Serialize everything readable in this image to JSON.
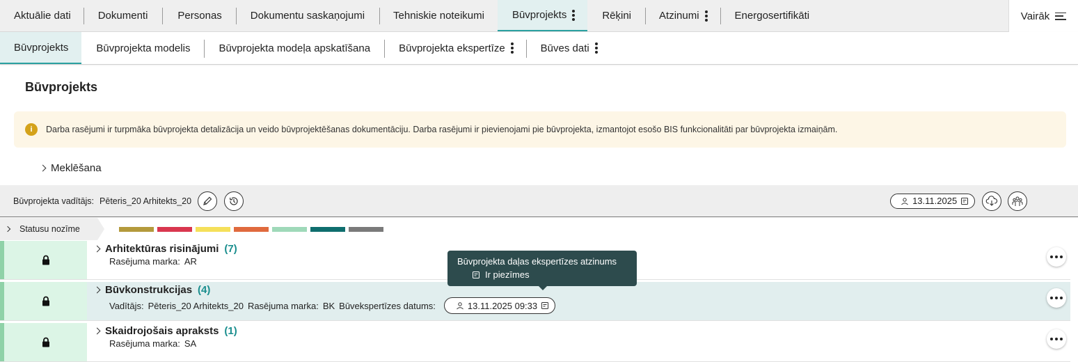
{
  "topnav": {
    "tabs": [
      {
        "label": "Aktuālie dati"
      },
      {
        "label": "Dokumenti"
      },
      {
        "label": "Personas"
      },
      {
        "label": "Dokumentu saskaņojumi"
      },
      {
        "label": "Tehniskie noteikumi"
      },
      {
        "label": "Būvprojekts"
      },
      {
        "label": "Rēķini"
      },
      {
        "label": "Atzinumi"
      },
      {
        "label": "Energosertifikāti"
      }
    ],
    "more_label": "Vairāk"
  },
  "subnav": {
    "tabs": [
      {
        "label": "Būvprojekts"
      },
      {
        "label": "Būvprojekta modelis"
      },
      {
        "label": "Būvprojekta modeļa apskatīšana"
      },
      {
        "label": "Būvprojekta ekspertīze"
      },
      {
        "label": "Būves dati"
      }
    ]
  },
  "page": {
    "title": "Būvprojekts"
  },
  "info": {
    "icon": "info-icon",
    "text": "Darba rasējumi ir turpmāka būvprojekta detalizācija un veido būvprojektēšanas dokumentāciju. Darba rasējumi ir pievienojami pie būvprojekta, izmantojot esošo BIS funkcionalitāti par būvprojekta izmaiņām."
  },
  "search": {
    "label": "Meklēšana"
  },
  "toolbar": {
    "manager_label": "Būvprojekta vadītājs:",
    "manager_name": "Pēteris_20 Arhitekts_20",
    "date": "13.11.2025"
  },
  "status": {
    "label": "Statusu nozīme",
    "colors": [
      "#b49a3c",
      "#d9374f",
      "#f5e05a",
      "#e06a3e",
      "#9fd9b9",
      "#0f6e6e",
      "#7a7a7a"
    ]
  },
  "rows": [
    {
      "name": "Arhitektūras risinājumi",
      "count": "(7)",
      "marka_label": "Rasējuma marka:",
      "marka": "AR"
    },
    {
      "name": "Būvkonstrukcijas",
      "count": "(4)",
      "vaditajs_label": "Vadītājs:",
      "vaditajs": "Pēteris_20 Arhitekts_20",
      "marka_label": "Rasējuma marka:",
      "marka": "BK",
      "expert_label": "Būvekspertīzes datums:",
      "expert_date": "13.11.2025 09:33"
    },
    {
      "name": "Skaidrojošais apraksts",
      "count": "(1)",
      "marka_label": "Rasējuma marka:",
      "marka": "SA"
    }
  ],
  "tooltip": {
    "title": "Būvprojekta daļas ekspertīzes atzinums",
    "note": "Ir piezīmes"
  }
}
